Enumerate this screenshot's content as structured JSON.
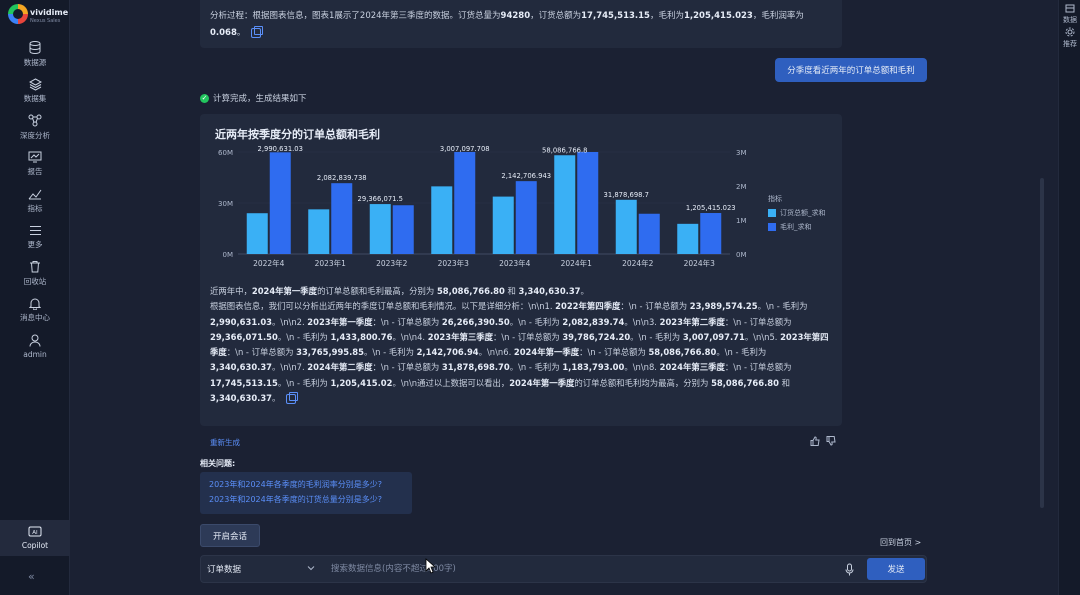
{
  "app": {
    "logo_name": "vividime",
    "logo_sub": "Nexus Sales"
  },
  "sidebar": {
    "items": [
      {
        "label": "数据源",
        "icon": "database-icon"
      },
      {
        "label": "数据集",
        "icon": "dataset-icon"
      },
      {
        "label": "深度分析",
        "icon": "analysis-icon"
      },
      {
        "label": "报告",
        "icon": "report-icon"
      },
      {
        "label": "指标",
        "icon": "metric-icon"
      },
      {
        "label": "更多",
        "icon": "menu-icon"
      },
      {
        "label": "回收站",
        "icon": "trash-icon"
      },
      {
        "label": "消息中心",
        "icon": "bell-icon"
      },
      {
        "label": "admin",
        "icon": "user-icon"
      }
    ],
    "copilot_label": "Copilot",
    "collapse_glyph": "«"
  },
  "rail": {
    "item1": "数据",
    "item2": "推荐"
  },
  "previous_answer": {
    "prefix": "分析过程：根据图表信息，图表1展示了2024年第三季度的数据。订货总量为",
    "qty": "94280",
    "mid1": "，订货总额为",
    "amount": "17,745,513.15",
    "mid2": "，毛利为",
    "profit": "1,205,415.023",
    "mid3": "，毛利润率为",
    "margin": "0.068",
    "suffix": "。"
  },
  "user_message": "分季度看近两年的订单总额和毛利",
  "status_text": "计算完成，生成结果如下",
  "chart_data": {
    "type": "bar",
    "title": "近两年按季度分的订单总额和毛利",
    "categories": [
      "2022年4",
      "2023年1",
      "2023年2",
      "2023年3",
      "2023年4",
      "2024年1",
      "2024年2",
      "2024年3"
    ],
    "series": [
      {
        "name": "订货总额_求和",
        "axis": "left",
        "color": "#3ab0f5",
        "values": [
          23989574.25,
          26266390.5,
          29366071.5,
          39786724.2,
          33765995.85,
          58086766.8,
          31878698.7,
          17745513.15
        ]
      },
      {
        "name": "毛利_求和",
        "axis": "right",
        "color": "#2f6cf0",
        "values": [
          2990631.03,
          2082839.738,
          1433800.76,
          3007097.708,
          2142706.943,
          3340630.37,
          1183793.0,
          1205415.023
        ]
      }
    ],
    "data_labels": [
      {
        "text": "2,990,631.03",
        "cat": 0,
        "series": 1
      },
      {
        "text": "2,082,839.738",
        "cat": 1,
        "series": 1
      },
      {
        "text": "29,366,071.5",
        "cat": 2,
        "series": 0
      },
      {
        "text": "3,007,097.708",
        "cat": 3,
        "series": 1
      },
      {
        "text": "2,142,706.943",
        "cat": 4,
        "series": 1
      },
      {
        "text": "58,086,766.8",
        "cat": 5,
        "series": 0
      },
      {
        "text": "31,878,698.7",
        "cat": 6,
        "series": 0
      },
      {
        "text": "1,205,415.023",
        "cat": 7,
        "series": 1
      }
    ],
    "ylim_left": [
      0,
      60000000
    ],
    "ylim_right": [
      0,
      3000000
    ],
    "left_ticks": [
      "0M",
      "30M",
      "60M"
    ],
    "right_ticks": [
      "0M",
      "1M",
      "2M",
      "3M"
    ],
    "legend_title": "指标",
    "legend_position": "right"
  },
  "analysis": {
    "p1_a": "近两年中，",
    "p1_b": "2024年第一季度",
    "p1_c": "的订单总额和毛利最高，分别为 ",
    "p1_d": "58,086,766.80",
    "p1_e": " 和 ",
    "p1_f": "3,340,630.37",
    "p1_g": "。",
    "p2": "根据图表信息，我们可以分析出近两年的季度订单总额和毛利情况。以下是详细分析：\\n\\n1. ",
    "q1h": "2022年第四季度",
    "q1t": "：\\n - 订单总额为 ",
    "q1v": "23,989,574.25",
    "q1t2": "。\\n - 毛利为 ",
    "q1p": "2,990,631.03",
    "q2pre": "。\\n\\n2. ",
    "q2h": "2023年第一季度",
    "q2t": "：\\n - 订单总额为 ",
    "q2v": "26,266,390.50",
    "q2t2": "。\\n - 毛利为 ",
    "q2p": "2,082,839.74",
    "q3pre": "。\\n\\n3. ",
    "q3h": "2023年第二季度",
    "q3t": "：\\n - 订单总额为 ",
    "q3v": "29,366,071.50",
    "q3t2": "。\\n - 毛利为 ",
    "q3p": "1,433,800.76",
    "q4pre": "。\\n\\n4. ",
    "q4h": "2023年第三季度",
    "q4t": "：\\n - 订单总额为 ",
    "q4v": "39,786,724.20",
    "q4t2": "。\\n - 毛利为 ",
    "q4p": "3,007,097.71",
    "q5pre": "。\\n\\n5. ",
    "q5h": "2023年第四季度",
    "q5t": "：\\n - 订单总额为 ",
    "q5v": "33,765,995.85",
    "q5t2": "。\\n - 毛利为 ",
    "q5p": "2,142,706.94",
    "q6pre": "。\\n\\n6. ",
    "q6h": "2024年第一季度",
    "q6t": "：\\n - 订单总额为 ",
    "q6v": "58,086,766.80",
    "q6t2": "。\\n - 毛利为 ",
    "q6p": "3,340,630.37",
    "q7pre": "。\\n\\n7. ",
    "q7h": "2024年第二季度",
    "q7t": "：\\n - 订单总额为 ",
    "q7v": "31,878,698.70",
    "q7t2": "。\\n - 毛利为 ",
    "q7p": "1,183,793.00",
    "q8pre": "。\\n\\n8. ",
    "q8h": "2024年第三季度",
    "q8t": "：\\n - 订单总额为 ",
    "q8v": "17,745,513.15",
    "q8t2": "。\\n - 毛利为 ",
    "q8p": "1,205,415.02",
    "c_a": "。\\n\\n通过以上数据可以看出，",
    "c_b": "2024年第一季度",
    "c_c": "的订单总额和毛利均为最高，分别为 ",
    "c_d": "58,086,766.80",
    "c_e": " 和 ",
    "c_f": "3,340,630.37",
    "c_g": "。"
  },
  "regenerate_label": "重新生成",
  "related": {
    "title": "相关问题:",
    "items": [
      "2023年和2024年各季度的毛利润率分别是多少?",
      "2023年和2024年各季度的订货总量分别是多少?"
    ]
  },
  "new_chat_label": "开启会话",
  "back_home_label": "回到首页 >",
  "input": {
    "dataset_value": "订单数据",
    "placeholder": "搜索数据信息(内容不超过200字)",
    "send_label": "发送"
  },
  "colors": {
    "accent": "#2f5fbf",
    "series_order_amount": "#3ab0f5",
    "series_profit": "#2f6cf0",
    "success": "#22c55e"
  }
}
